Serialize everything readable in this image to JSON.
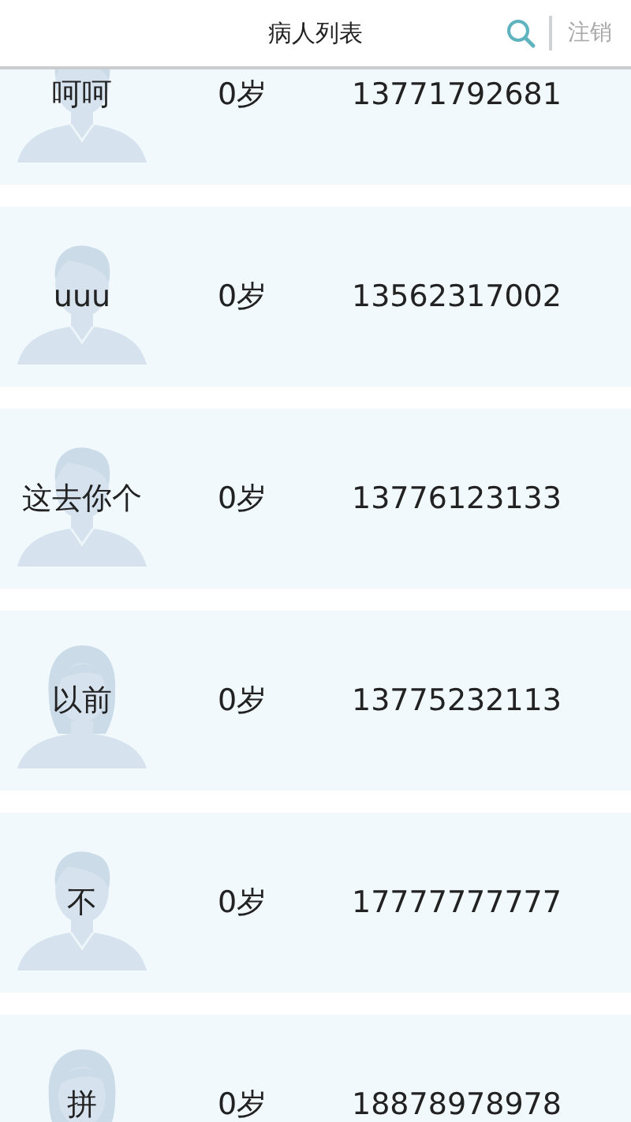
{
  "header": {
    "title": "病人列表",
    "logout": "注销"
  },
  "patients": [
    {
      "name": "呵呵",
      "age": "0岁",
      "phone": "13771792681",
      "kind": "male"
    },
    {
      "name": "uuu",
      "age": "0岁",
      "phone": "13562317002",
      "kind": "male"
    },
    {
      "name": "这去你个",
      "age": "0岁",
      "phone": "13776123133",
      "kind": "male"
    },
    {
      "name": "以前",
      "age": "0岁",
      "phone": "13775232113",
      "kind": "female"
    },
    {
      "name": "不",
      "age": "0岁",
      "phone": "17777777777",
      "kind": "male"
    },
    {
      "name": "拼",
      "age": "0岁",
      "phone": "18878978978",
      "kind": "female"
    }
  ]
}
